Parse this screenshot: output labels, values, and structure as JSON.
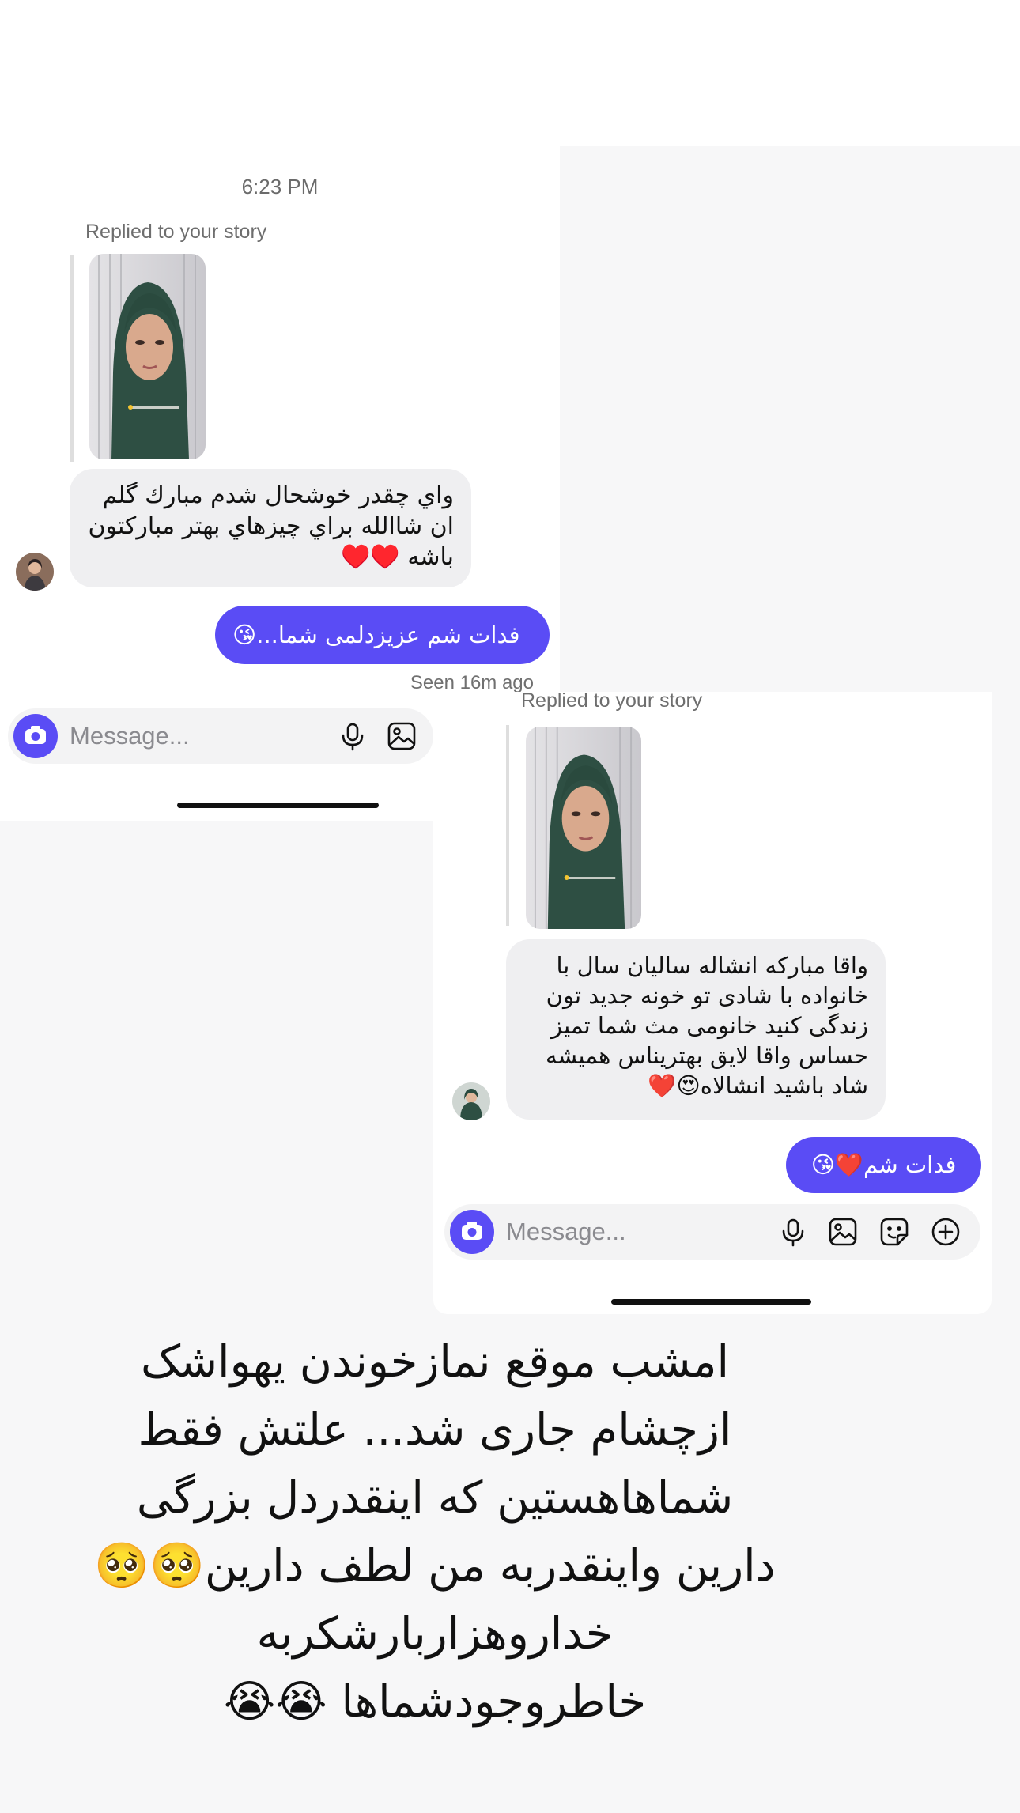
{
  "screenshot1": {
    "timestamp": "6:23 PM",
    "replied_label": "Replied to your story",
    "incoming_message": "واي چقدر خوشحال شدم مبارك گلم ان شاالله براي چيزهاي بهتر مباركتون باشه ♥️♥️",
    "outgoing_message": "فدات شم عزیزدلمی شما...😘",
    "seen_status": "Seen 16m ago",
    "composer_placeholder": "Message..."
  },
  "screenshot2": {
    "replied_label": "Replied to your story",
    "incoming_message": "واقا مبارکه انشاله  سالیان سال با خانواده با شادی تو خونه جدید تون زندگی کنید  خانومی مث شما تمیز حساس واقا لایق بهتریناس  همیشه شاد باشید انشالاه😍❤️",
    "outgoing_message": "فدات شم❤️😘",
    "composer_placeholder": "Message..."
  },
  "caption_lines": [
    "امشب موقع نمازخوندن یهواشک",
    "ازچشام جاری شد... علتش فقط",
    "شماهاهستین که اینقدردل بزرگی",
    "دارین واینقدربه من لطف دارین🥺🥺",
    "خداروهزاربارشکربه",
    "خاطروجودشماها 😭😭"
  ],
  "icons": {
    "camera": "camera-icon",
    "microphone": "microphone-icon",
    "gallery": "gallery-icon",
    "sticker": "sticker-icon",
    "add": "plus-circle-icon"
  },
  "colors": {
    "accent": "#5a4cf5",
    "incoming_bubble": "#efeff1",
    "background": "#f7f7f8"
  }
}
